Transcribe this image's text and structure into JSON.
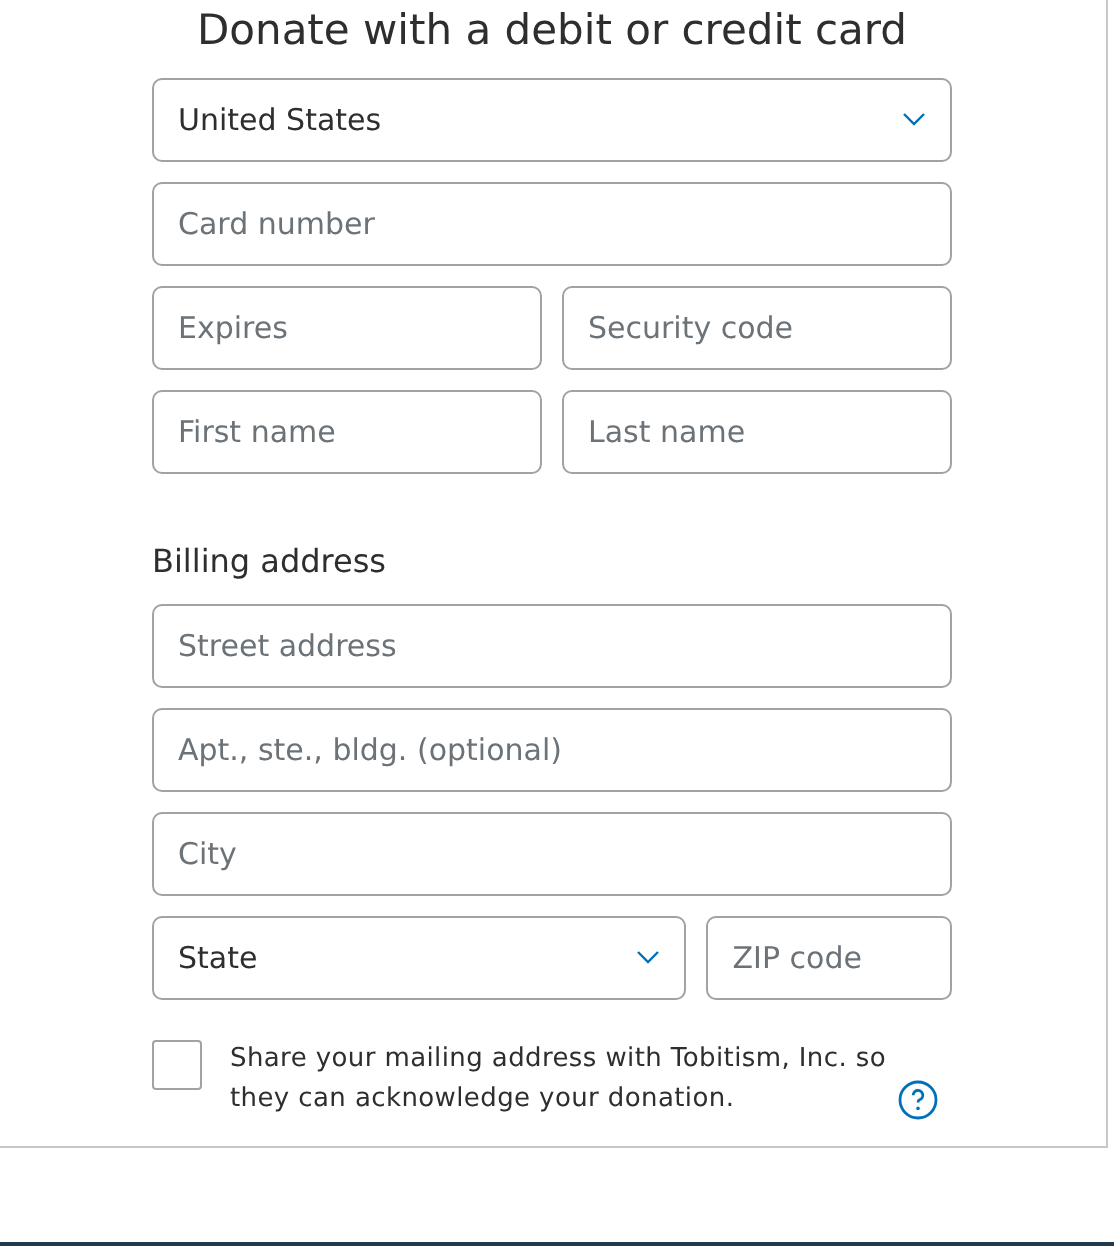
{
  "title": "Donate with a debit or credit card",
  "card_rows": [
    [
      {
        "kind": "select",
        "value": "United States"
      }
    ],
    [
      {
        "kind": "input",
        "placeholder": "Card number"
      }
    ],
    [
      {
        "kind": "input",
        "placeholder": "Expires"
      },
      {
        "kind": "input",
        "placeholder": "Security code"
      }
    ],
    [
      {
        "kind": "input",
        "placeholder": "First name"
      },
      {
        "kind": "input",
        "placeholder": "Last name"
      }
    ]
  ],
  "billing_heading": "Billing address",
  "billing_rows": [
    [
      {
        "kind": "input",
        "placeholder": "Street address"
      }
    ],
    [
      {
        "kind": "input",
        "placeholder": "Apt., ste., bldg. (optional)"
      }
    ],
    [
      {
        "kind": "input",
        "placeholder": "City"
      }
    ],
    [
      {
        "kind": "select",
        "value": "State"
      },
      {
        "kind": "input",
        "placeholder": "ZIP code"
      }
    ]
  ],
  "share_address": {
    "checked": false,
    "text": "Share your mailing address with Tobitism, Inc. so they can acknowledge your donation."
  }
}
